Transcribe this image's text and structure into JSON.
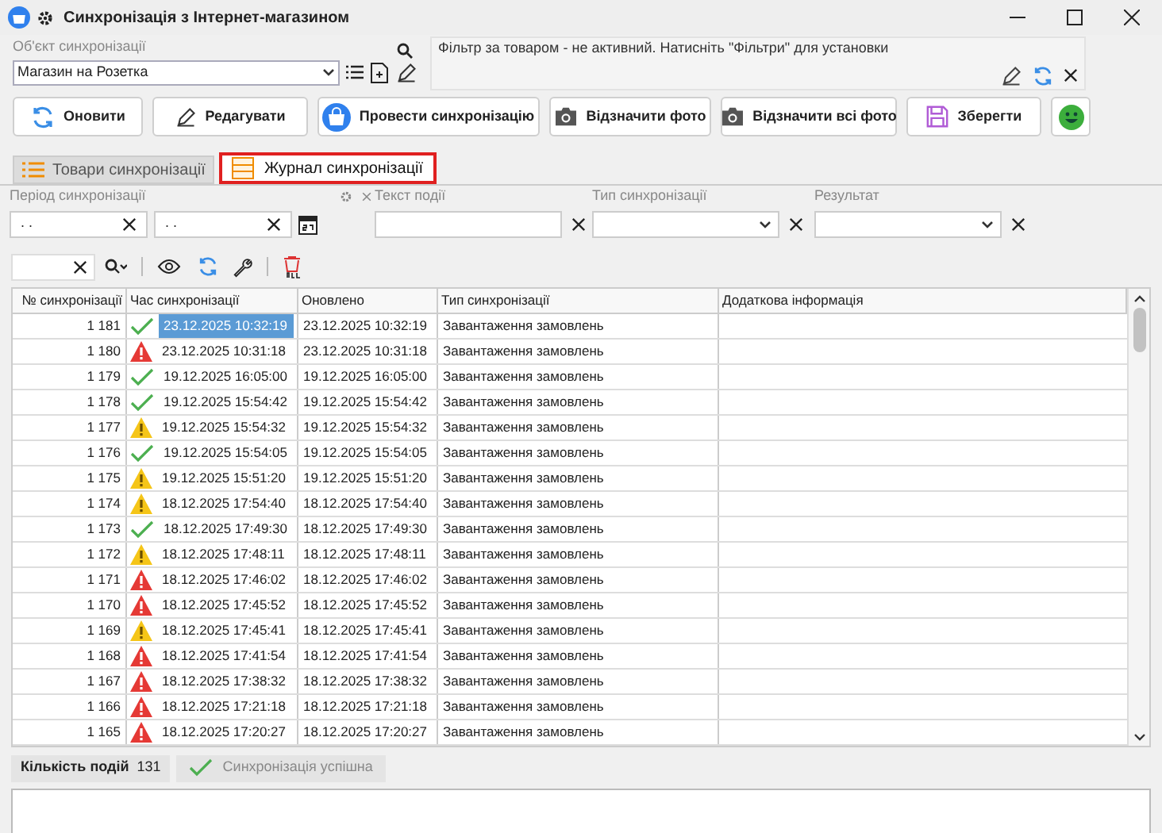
{
  "window": {
    "title": "Синхронізація з Інтернет-магазином"
  },
  "sync_object": {
    "label": "Об'єкт синхронізації",
    "value": "Магазин на Розетка"
  },
  "filter_notice": "Фільтр за товаром - не активний. Натисніть \"Фільтри\" для установки",
  "toolbar_buttons": [
    {
      "label": "Оновити",
      "kind": "refresh"
    },
    {
      "label": "Редагувати",
      "kind": "edit"
    },
    {
      "label": "Провести синхронізацію",
      "kind": "sync"
    },
    {
      "label": "Відзначити фото",
      "kind": "camera"
    },
    {
      "label": "Відзначити всі фото",
      "kind": "camera"
    },
    {
      "label": "Зберегти",
      "kind": "save"
    }
  ],
  "tabs": [
    {
      "label": "Товари синхронізації",
      "selected": false,
      "kind": "list"
    },
    {
      "label": "Журнал синхронізації",
      "selected": true,
      "kind": "journal"
    }
  ],
  "filters": {
    "period_label": "Період синхронізації",
    "period_from": ". .",
    "period_to": ". .",
    "event_text_label": "Текст події",
    "sync_type_label": "Тип синхронізації",
    "result_label": "Результат"
  },
  "table": {
    "columns": [
      "№ синхронізації",
      "Час синхронізації",
      "Оновлено",
      "Тип синхронізації",
      "Додаткова інформація"
    ],
    "rows": [
      {
        "number": "1 181",
        "kind": "ok",
        "time": "23.12.2025 10:32:19",
        "updated": "23.12.2025 10:32:19",
        "type": "Завантаження замовлень",
        "selected": true
      },
      {
        "number": "1 180",
        "kind": "error",
        "time": "23.12.2025 10:31:18",
        "updated": "23.12.2025 10:31:18",
        "type": "Завантаження замовлень",
        "selected": false
      },
      {
        "number": "1 179",
        "kind": "ok",
        "time": "19.12.2025 16:05:00",
        "updated": "19.12.2025 16:05:00",
        "type": "Завантаження замовлень",
        "selected": false
      },
      {
        "number": "1 178",
        "kind": "ok",
        "time": "19.12.2025 15:54:42",
        "updated": "19.12.2025 15:54:42",
        "type": "Завантаження замовлень",
        "selected": false
      },
      {
        "number": "1 177",
        "kind": "warning",
        "time": "19.12.2025 15:54:32",
        "updated": "19.12.2025 15:54:32",
        "type": "Завантаження замовлень",
        "selected": false
      },
      {
        "number": "1 176",
        "kind": "ok",
        "time": "19.12.2025 15:54:05",
        "updated": "19.12.2025 15:54:05",
        "type": "Завантаження замовлень",
        "selected": false
      },
      {
        "number": "1 175",
        "kind": "warning",
        "time": "19.12.2025 15:51:20",
        "updated": "19.12.2025 15:51:20",
        "type": "Завантаження замовлень",
        "selected": false
      },
      {
        "number": "1 174",
        "kind": "warning",
        "time": "18.12.2025 17:54:40",
        "updated": "18.12.2025 17:54:40",
        "type": "Завантаження замовлень",
        "selected": false
      },
      {
        "number": "1 173",
        "kind": "ok",
        "time": "18.12.2025 17:49:30",
        "updated": "18.12.2025 17:49:30",
        "type": "Завантаження замовлень",
        "selected": false
      },
      {
        "number": "1 172",
        "kind": "warning",
        "time": "18.12.2025 17:48:11",
        "updated": "18.12.2025 17:48:11",
        "type": "Завантаження замовлень",
        "selected": false
      },
      {
        "number": "1 171",
        "kind": "error",
        "time": "18.12.2025 17:46:02",
        "updated": "18.12.2025 17:46:02",
        "type": "Завантаження замовлень",
        "selected": false
      },
      {
        "number": "1 170",
        "kind": "error",
        "time": "18.12.2025 17:45:52",
        "updated": "18.12.2025 17:45:52",
        "type": "Завантаження замовлень",
        "selected": false
      },
      {
        "number": "1 169",
        "kind": "warning",
        "time": "18.12.2025 17:45:41",
        "updated": "18.12.2025 17:45:41",
        "type": "Завантаження замовлень",
        "selected": false
      },
      {
        "number": "1 168",
        "kind": "error",
        "time": "18.12.2025 17:41:54",
        "updated": "18.12.2025 17:41:54",
        "type": "Завантаження замовлень",
        "selected": false
      },
      {
        "number": "1 167",
        "kind": "error",
        "time": "18.12.2025 17:38:32",
        "updated": "18.12.2025 17:38:32",
        "type": "Завантаження замовлень",
        "selected": false
      },
      {
        "number": "1 166",
        "kind": "error",
        "time": "18.12.2025 17:21:18",
        "updated": "18.12.2025 17:21:18",
        "type": "Завантаження замовлень",
        "selected": false
      },
      {
        "number": "1 165",
        "kind": "error",
        "time": "18.12.2025 17:20:27",
        "updated": "18.12.2025 17:20:27",
        "type": "Завантаження замовлень",
        "selected": false
      }
    ]
  },
  "status_bar": {
    "count_label": "Кількість подій",
    "count": "131",
    "result": {
      "text": "Синхронізація успішна",
      "kind": "ok"
    }
  }
}
